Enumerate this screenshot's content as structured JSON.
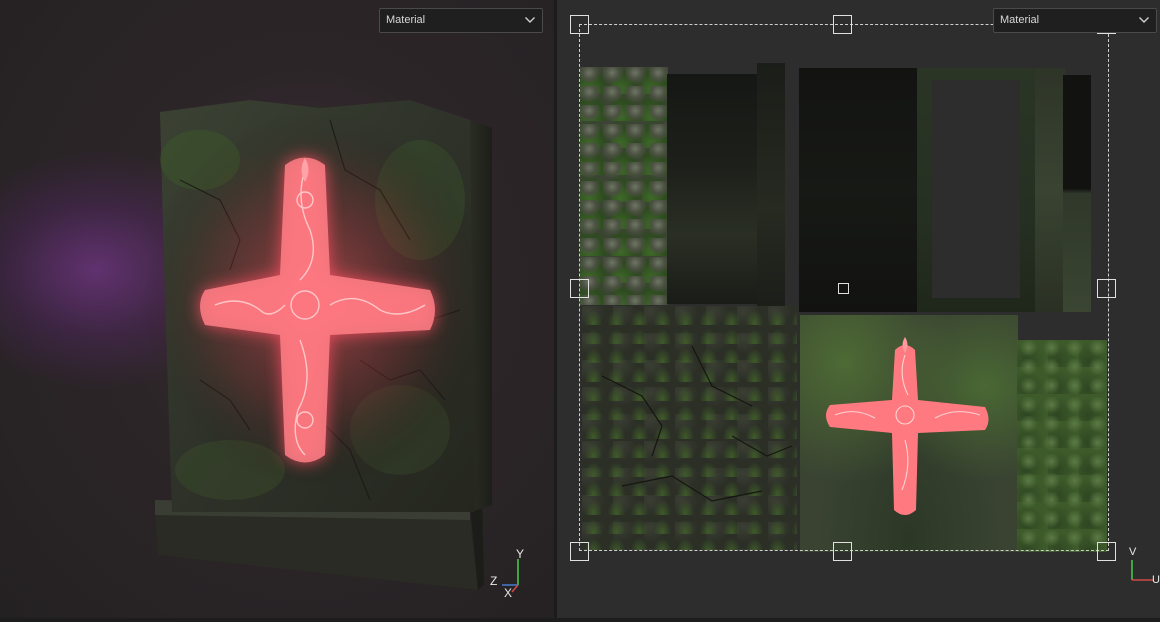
{
  "viewport_3d": {
    "material_dropdown": {
      "selected": "Material"
    },
    "gizmo": {
      "y": "Y",
      "z": "Z",
      "x": "X"
    }
  },
  "viewport_uv": {
    "material_dropdown": {
      "selected": "Material"
    },
    "gizmo": {
      "v": "V",
      "u": "U"
    }
  },
  "colors": {
    "glow": "#ff6a6a",
    "moss": "#3d5a2a",
    "stone": "#3a3c34",
    "selection": "#e0e0e0"
  },
  "icons": [
    "chevron-down-icon",
    "cross-emblem-icon",
    "axis-gizmo-icon"
  ]
}
